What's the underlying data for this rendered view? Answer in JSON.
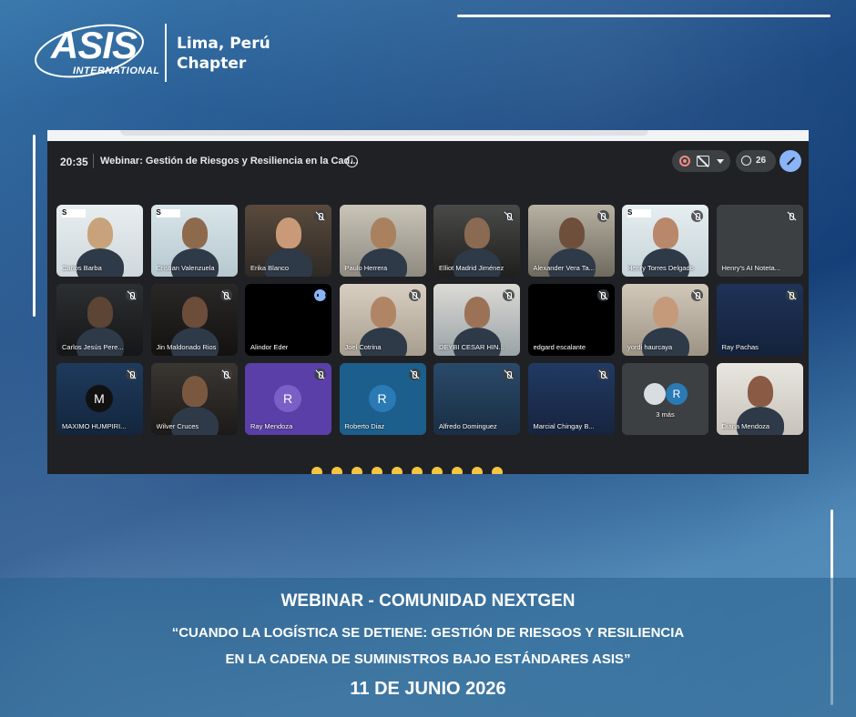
{
  "logo": {
    "brand": "ASIS",
    "brand_sub": "INTERNATIONAL",
    "chapter_line1": "Lima, Perú",
    "chapter_line2": "Chapter"
  },
  "meeting": {
    "time": "20:35",
    "title": "Webinar: Gestión de Riesgos y Resiliencia en la Cad...",
    "participant_count": "26"
  },
  "participants": [
    {
      "name": "Carlos Barba",
      "mic": "none",
      "avatar": ""
    },
    {
      "name": "Cristian Valenzuela",
      "mic": "none",
      "avatar": ""
    },
    {
      "name": "Erika Blanco",
      "mic": "muted",
      "avatar": ""
    },
    {
      "name": "Paulo Herrera",
      "mic": "none",
      "avatar": ""
    },
    {
      "name": "Elliot Madrid Jiménez",
      "mic": "muted",
      "avatar": ""
    },
    {
      "name": "Alexander Vera Ta...",
      "mic": "muted",
      "avatar": ""
    },
    {
      "name": "Henry Torres Delgado",
      "mic": "muted",
      "avatar": ""
    },
    {
      "name": "Henry's AI Noteta...",
      "mic": "muted",
      "avatar": ""
    },
    {
      "name": "Carlos Jesús Pere...",
      "mic": "muted",
      "avatar": ""
    },
    {
      "name": "Jin Maldonado Rios",
      "mic": "muted",
      "avatar": ""
    },
    {
      "name": "Alindor Eder",
      "mic": "speaking",
      "avatar": ""
    },
    {
      "name": "Joel Cotrina",
      "mic": "muted",
      "avatar": ""
    },
    {
      "name": "DEYBI CESAR HIN...",
      "mic": "muted",
      "avatar": ""
    },
    {
      "name": "edgard escalante",
      "mic": "muted",
      "avatar": ""
    },
    {
      "name": "yordi haurcaya",
      "mic": "muted",
      "avatar": ""
    },
    {
      "name": "Ray Pachas",
      "mic": "muted",
      "avatar": ""
    },
    {
      "name": "MAXIMO HUMPIRI...",
      "mic": "muted",
      "avatar": "M"
    },
    {
      "name": "Wilver Cruces",
      "mic": "muted",
      "avatar": ""
    },
    {
      "name": "Ray Mendoza",
      "mic": "muted",
      "avatar": "R"
    },
    {
      "name": "Roberto Diaz",
      "mic": "muted",
      "avatar": "R"
    },
    {
      "name": "Alfredo Dominguez",
      "mic": "muted",
      "avatar": ""
    },
    {
      "name": "Marcial Chingay B...",
      "mic": "muted",
      "avatar": ""
    },
    {
      "name": "3 más",
      "mic": "none",
      "avatar": "R"
    },
    {
      "name": "Diana Mendoza",
      "mic": "none",
      "avatar": ""
    }
  ],
  "banner": {
    "title": "WEBINAR - COMUNIDAD NEXTGEN",
    "subtitle_line1": "“CUANDO LA LOGÍSTICA SE DETIENE: GESTIÓN DE RIESGOS Y RESILIENCIA",
    "subtitle_line2": "EN LA CADENA DE SUMINISTROS BAJO ESTÁNDARES ASIS”",
    "date": "11 DE JUNIO 2026"
  },
  "colors": {
    "accent": "#8ab4f8",
    "meet_bg": "#202124",
    "tile_bg": "#3c4043",
    "record": "#f28b82"
  }
}
